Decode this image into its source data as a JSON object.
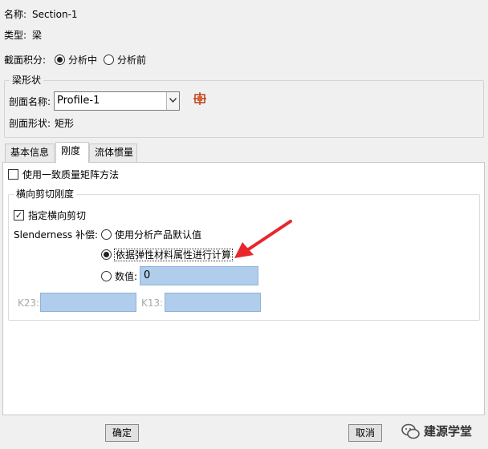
{
  "header": {
    "name_label": "名称:",
    "name_value": "Section-1",
    "type_label": "类型:",
    "type_value": "梁"
  },
  "section_integration": {
    "label": "截面积分:",
    "options": [
      {
        "label": "分析中",
        "selected": true
      },
      {
        "label": "分析前",
        "selected": false
      }
    ]
  },
  "beam_shape": {
    "title": "梁形状",
    "profile_label": "剖面名称:",
    "profile_value": "Profile-1",
    "create_icon": "profile-create-icon",
    "shape_label": "剖面形状:",
    "shape_value": "矩形"
  },
  "tabs": [
    {
      "label": "基本信息",
      "active": false
    },
    {
      "label": "刚度",
      "active": true
    },
    {
      "label": "流体惯量",
      "active": false
    }
  ],
  "stiffness": {
    "consistent_mass": {
      "label": "使用一致质量矩阵方法",
      "checked": false
    },
    "shear_group": {
      "title": "横向剪切刚度",
      "specify_shear": {
        "label": "指定横向剪切",
        "checked": true
      },
      "slenderness_label": "Slenderness 补偿:",
      "options": [
        {
          "label": "使用分析产品默认值",
          "selected": false
        },
        {
          "label": "依据弹性材料属性进行计算",
          "selected": true
        },
        {
          "label": "数值:",
          "selected": false
        }
      ],
      "value": "0",
      "k23_label": "K23:",
      "k23_value": "",
      "k13_label": "K13:",
      "k13_value": ""
    }
  },
  "footer": {
    "ok_label": "确定",
    "cancel_label": "取消",
    "watermark": "建源学堂"
  },
  "colors": {
    "annotation_arrow": "#e8262d",
    "field_fill": "#b0cdeb"
  }
}
